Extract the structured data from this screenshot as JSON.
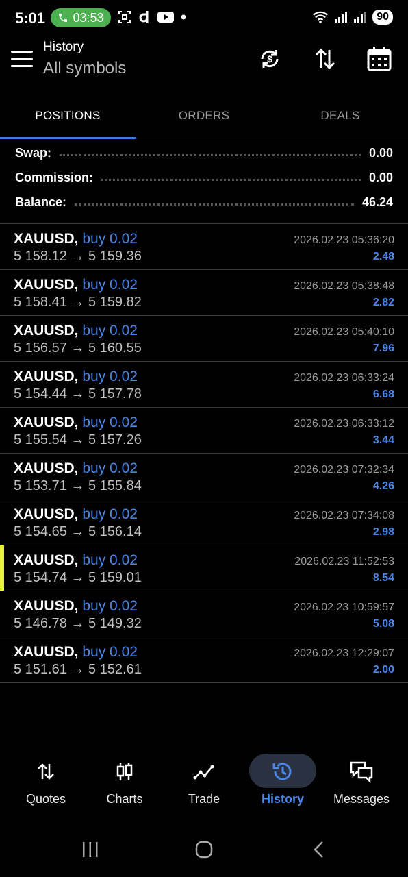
{
  "status_bar": {
    "time": "5:01",
    "call_timer": "03:53",
    "battery": "90",
    "icons": [
      "phone-icon",
      "scan-icon",
      "dash-app-icon",
      "youtube-icon",
      "dot-icon",
      "wifi-icon",
      "signal-icon",
      "signal-icon"
    ]
  },
  "header": {
    "title": "History",
    "subtitle": "All symbols",
    "icons": [
      "menu-icon",
      "currency-exchange-icon",
      "sort-icon",
      "calendar-icon"
    ]
  },
  "tabs": [
    {
      "label": "POSITIONS",
      "active": true
    },
    {
      "label": "ORDERS",
      "active": false
    },
    {
      "label": "DEALS",
      "active": false
    }
  ],
  "summary": {
    "swap_label": "Swap:",
    "swap_value": "0.00",
    "commission_label": "Commission:",
    "commission_value": "0.00",
    "balance_label": "Balance:",
    "balance_value": "46.24"
  },
  "deals": [
    {
      "symbol": "XAUUSD,",
      "type": "buy 0.02",
      "prices": "5 158.12 → 5 159.36",
      "time": "2026.02.23 05:36:20",
      "profit": "2.48"
    },
    {
      "symbol": "XAUUSD,",
      "type": "buy 0.02",
      "prices": "5 158.41 → 5 159.82",
      "time": "2026.02.23 05:38:48",
      "profit": "2.82"
    },
    {
      "symbol": "XAUUSD,",
      "type": "buy 0.02",
      "prices": "5 156.57 → 5 160.55",
      "time": "2026.02.23 05:40:10",
      "profit": "7.96"
    },
    {
      "symbol": "XAUUSD,",
      "type": "buy 0.02",
      "prices": "5 154.44 → 5 157.78",
      "time": "2026.02.23 06:33:24",
      "profit": "6.68"
    },
    {
      "symbol": "XAUUSD,",
      "type": "buy 0.02",
      "prices": "5 155.54 → 5 157.26",
      "time": "2026.02.23 06:33:12",
      "profit": "3.44"
    },
    {
      "symbol": "XAUUSD,",
      "type": "buy 0.02",
      "prices": "5 153.71 → 5 155.84",
      "time": "2026.02.23 07:32:34",
      "profit": "4.26"
    },
    {
      "symbol": "XAUUSD,",
      "type": "buy 0.02",
      "prices": "5 154.65 → 5 156.14",
      "time": "2026.02.23 07:34:08",
      "profit": "2.98"
    },
    {
      "symbol": "XAUUSD,",
      "type": "buy 0.02",
      "prices": "5 154.74 → 5 159.01",
      "time": "2026.02.23 11:52:53",
      "profit": "8.54",
      "highlighted": true
    },
    {
      "symbol": "XAUUSD,",
      "type": "buy 0.02",
      "prices": "5 146.78 → 5 149.32",
      "time": "2026.02.23 10:59:57",
      "profit": "5.08"
    },
    {
      "symbol": "XAUUSD,",
      "type": "buy 0.02",
      "prices": "5 151.61 → 5 152.61",
      "time": "2026.02.23 12:29:07",
      "profit": "2.00"
    }
  ],
  "bottom_nav": [
    {
      "label": "Quotes",
      "icon": "quotes-icon",
      "active": false
    },
    {
      "label": "Charts",
      "icon": "charts-icon",
      "active": false
    },
    {
      "label": "Trade",
      "icon": "trade-icon",
      "active": false
    },
    {
      "label": "History",
      "icon": "history-icon",
      "active": true
    },
    {
      "label": "Messages",
      "icon": "messages-icon",
      "active": false
    }
  ],
  "colors": {
    "background": "#000000",
    "accent_blue": "#4a86e8",
    "tab_underline": "#3f7be0",
    "highlight_marker": "#e8f23a",
    "call_pill": "#4caf50"
  }
}
